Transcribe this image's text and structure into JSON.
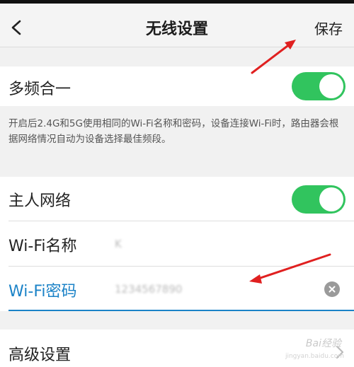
{
  "header": {
    "title": "无线设置",
    "save_label": "保存"
  },
  "dual_band": {
    "label": "多频合一",
    "enabled": true,
    "description": "开启后2.4G和5G使用相同的Wi-Fi名称和密码，设备连接Wi-Fi时，路由器会根据网络情况自动为设备选择最佳频段。"
  },
  "main_network": {
    "label": "主人网络",
    "enabled": true
  },
  "wifi_name": {
    "label": "Wi-Fi名称",
    "value": "K"
  },
  "wifi_password": {
    "label": "Wi-Fi密码",
    "value": "1234567890"
  },
  "advanced": {
    "label": "高级设置"
  },
  "watermark": {
    "text": "Bai经验",
    "sub": "jingyan.baidu.com"
  },
  "colors": {
    "accent": "#1a82c7",
    "toggle_on": "#31c45e",
    "annotation": "#e02020"
  }
}
